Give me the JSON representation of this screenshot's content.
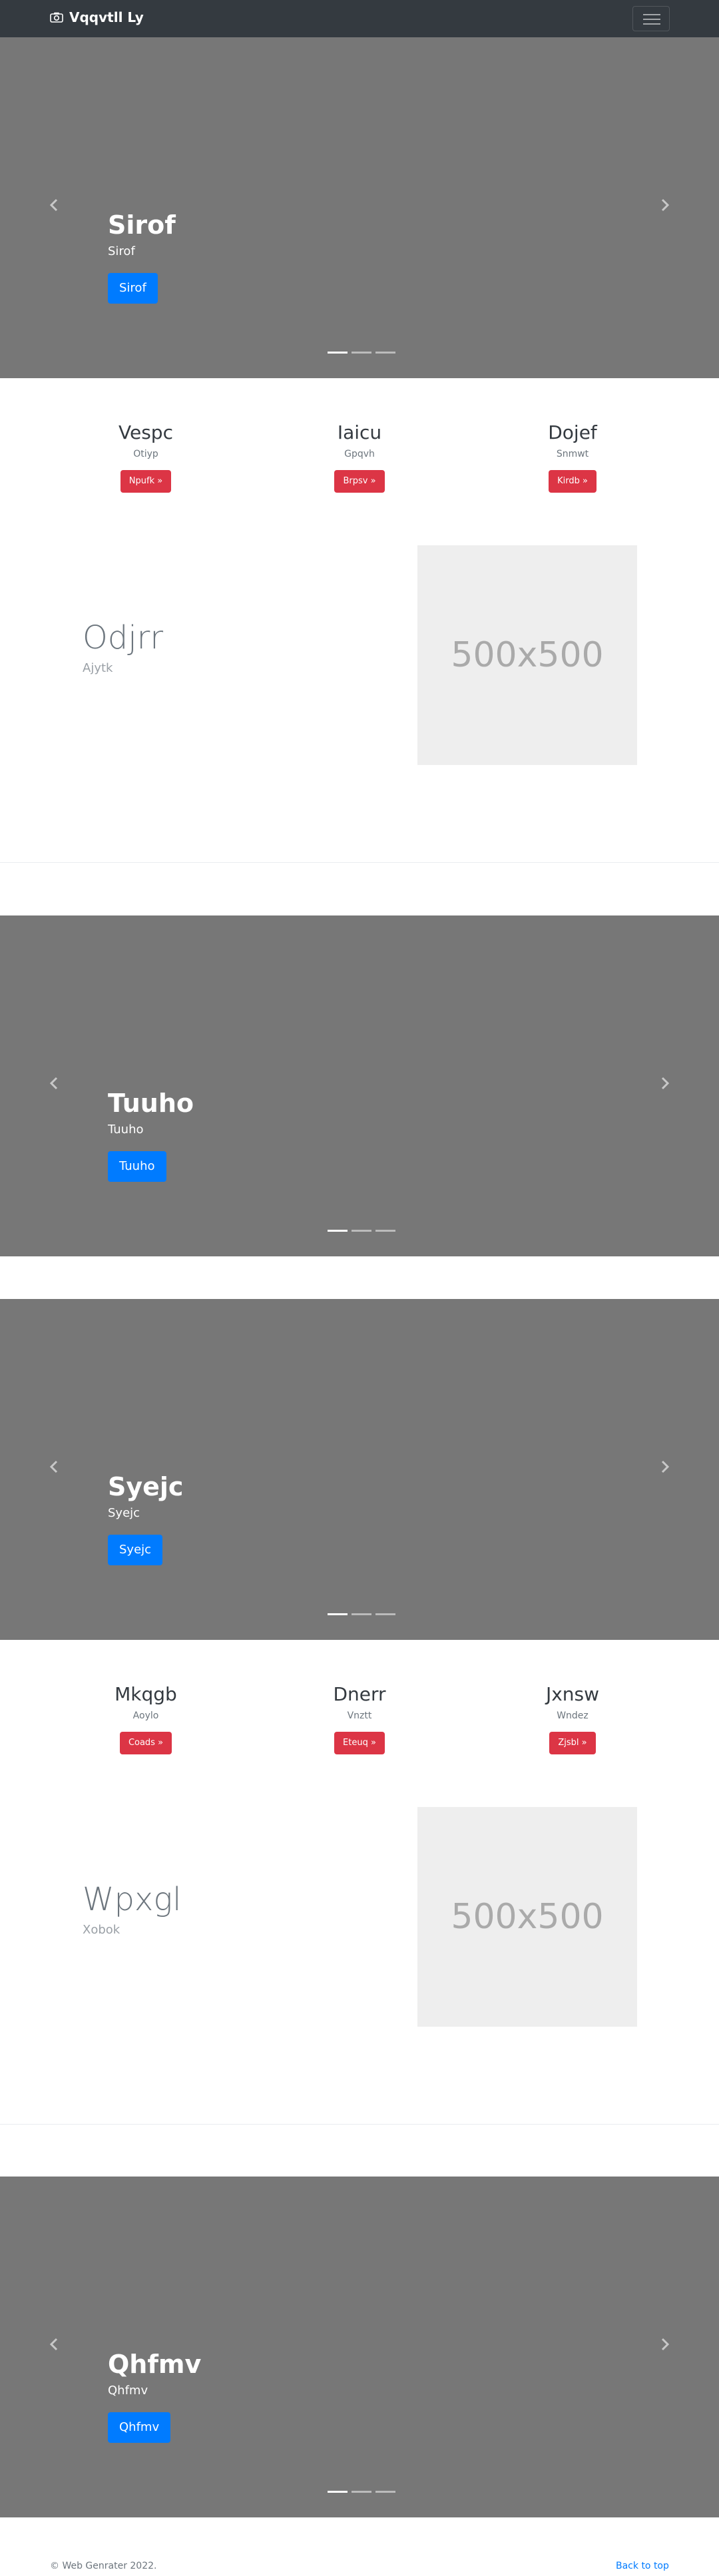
{
  "navbar": {
    "brand": "Vqqvtll Ly",
    "brand_icon": "camera-icon",
    "toggle_icon": "hamburger-icon"
  },
  "sections": [
    {
      "carousel": {
        "title": "Sirof",
        "subtitle": "Sirof",
        "button": "Sirof"
      },
      "features": [
        {
          "title": "Vespc",
          "text": "Otiyp",
          "button": "Npufk »"
        },
        {
          "title": "Iaicu",
          "text": "Gpqvh",
          "button": "Brpsv »"
        },
        {
          "title": "Dojef",
          "text": "Snmwt",
          "button": "Kirdb »"
        }
      ],
      "featurette": {
        "heading": "Odjrr",
        "subheading": "Ajytk",
        "image": "500x500"
      }
    },
    {
      "carousel": {
        "title": "Tuuho",
        "subtitle": "Tuuho",
        "button": "Tuuho"
      }
    },
    {
      "carousel": {
        "title": "Syejc",
        "subtitle": "Syejc",
        "button": "Syejc"
      },
      "features": [
        {
          "title": "Mkqgb",
          "text": "Aoylo",
          "button": "Coads »"
        },
        {
          "title": "Dnerr",
          "text": "Vnztt",
          "button": "Eteuq »"
        },
        {
          "title": "Jxnsw",
          "text": "Wndez",
          "button": "Zjsbl »"
        }
      ],
      "featurette": {
        "heading": "Wpxgl",
        "subheading": "Xobok",
        "image": "500x500"
      }
    },
    {
      "carousel": {
        "title": "Qhfmv",
        "subtitle": "Qhfmv",
        "button": "Qhfmv"
      }
    }
  ],
  "footer": {
    "copyright": "© Web Genrater 2022.",
    "back_to_top": "Back to top"
  }
}
